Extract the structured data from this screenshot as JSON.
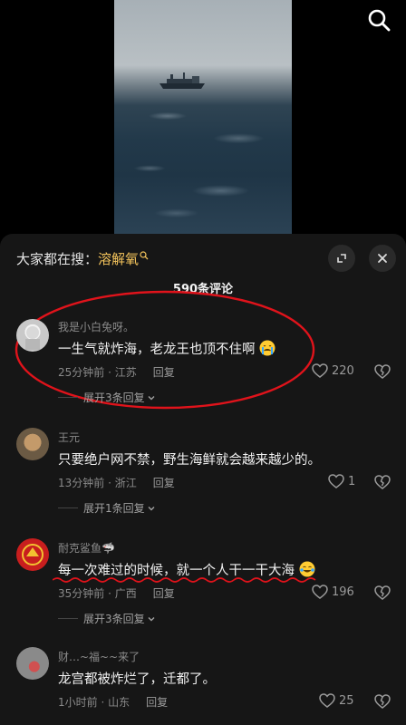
{
  "search_hint": {
    "prefix": "大家都在搜：",
    "keyword": "溶解氧"
  },
  "comment_count": "590条评论",
  "comments": [
    {
      "name": "我是小白兔呀。",
      "text": "一生气就炸海，老龙王也顶不住啊",
      "time": "25分钟前 · 江苏",
      "reply": "回复",
      "likes": "220",
      "more": "展开3条回复"
    },
    {
      "name": "王元",
      "text": "只要绝户网不禁，野生海鲜就会越来越少的。",
      "time": "13分钟前 · 浙江",
      "reply": "回复",
      "likes": "1",
      "more": "展开1条回复"
    },
    {
      "name": "耐克鲨鱼🦈",
      "text": "每一次难过的时候，就一个人干一干大海",
      "time": "35分钟前 · 广西",
      "reply": "回复",
      "likes": "196",
      "more": "展开3条回复"
    },
    {
      "name": "财…~福~~来了",
      "text": "龙宫都被炸烂了，迁都了。",
      "time": "1小时前 · 山东",
      "reply": "回复",
      "likes": "25"
    }
  ],
  "icons": {
    "search": "search-icon",
    "expand": "expand-icon",
    "close": "close-icon",
    "like": "heart-icon",
    "dislike": "broken-heart-icon",
    "expand_replies": "chevron-down-icon"
  },
  "colors": {
    "keyword": "#f4c45c",
    "panel_bg": "#161616",
    "annotation": "#e0131b"
  }
}
